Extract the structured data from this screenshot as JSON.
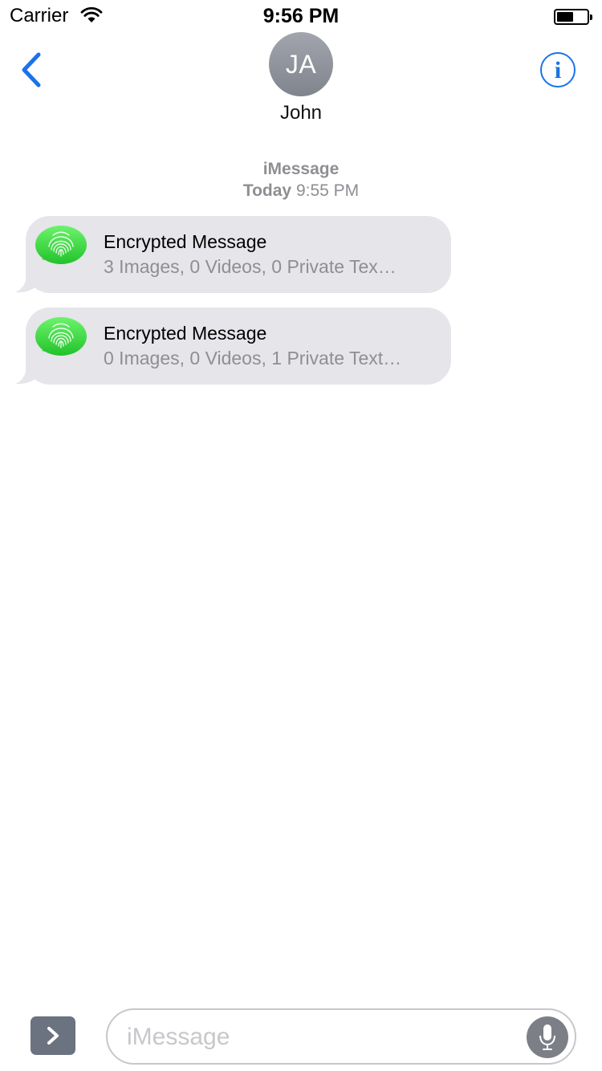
{
  "status_bar": {
    "carrier": "Carrier",
    "time": "9:56 PM",
    "battery_level": 0.55
  },
  "header": {
    "back_icon": "chevron-left-icon",
    "avatar_initials": "JA",
    "contact_name": "John",
    "info_icon": "info-circle-icon",
    "accent_color": "#1a73e8"
  },
  "conversation": {
    "service_label": "iMessage",
    "day_label": "Today",
    "time_label": "9:55 PM",
    "messages": [
      {
        "icon": "fingerprint-app-icon",
        "title": "Encrypted Message",
        "caption": "3 Images, 0 Videos, 0 Private Tex…"
      },
      {
        "icon": "fingerprint-app-icon",
        "title": "Encrypted Message",
        "caption": "0 Images, 0 Videos, 1 Private Text…"
      }
    ]
  },
  "input_bar": {
    "apps_icon": "chevron-right-icon",
    "placeholder": "iMessage",
    "value": "",
    "mic_icon": "microphone-icon"
  }
}
